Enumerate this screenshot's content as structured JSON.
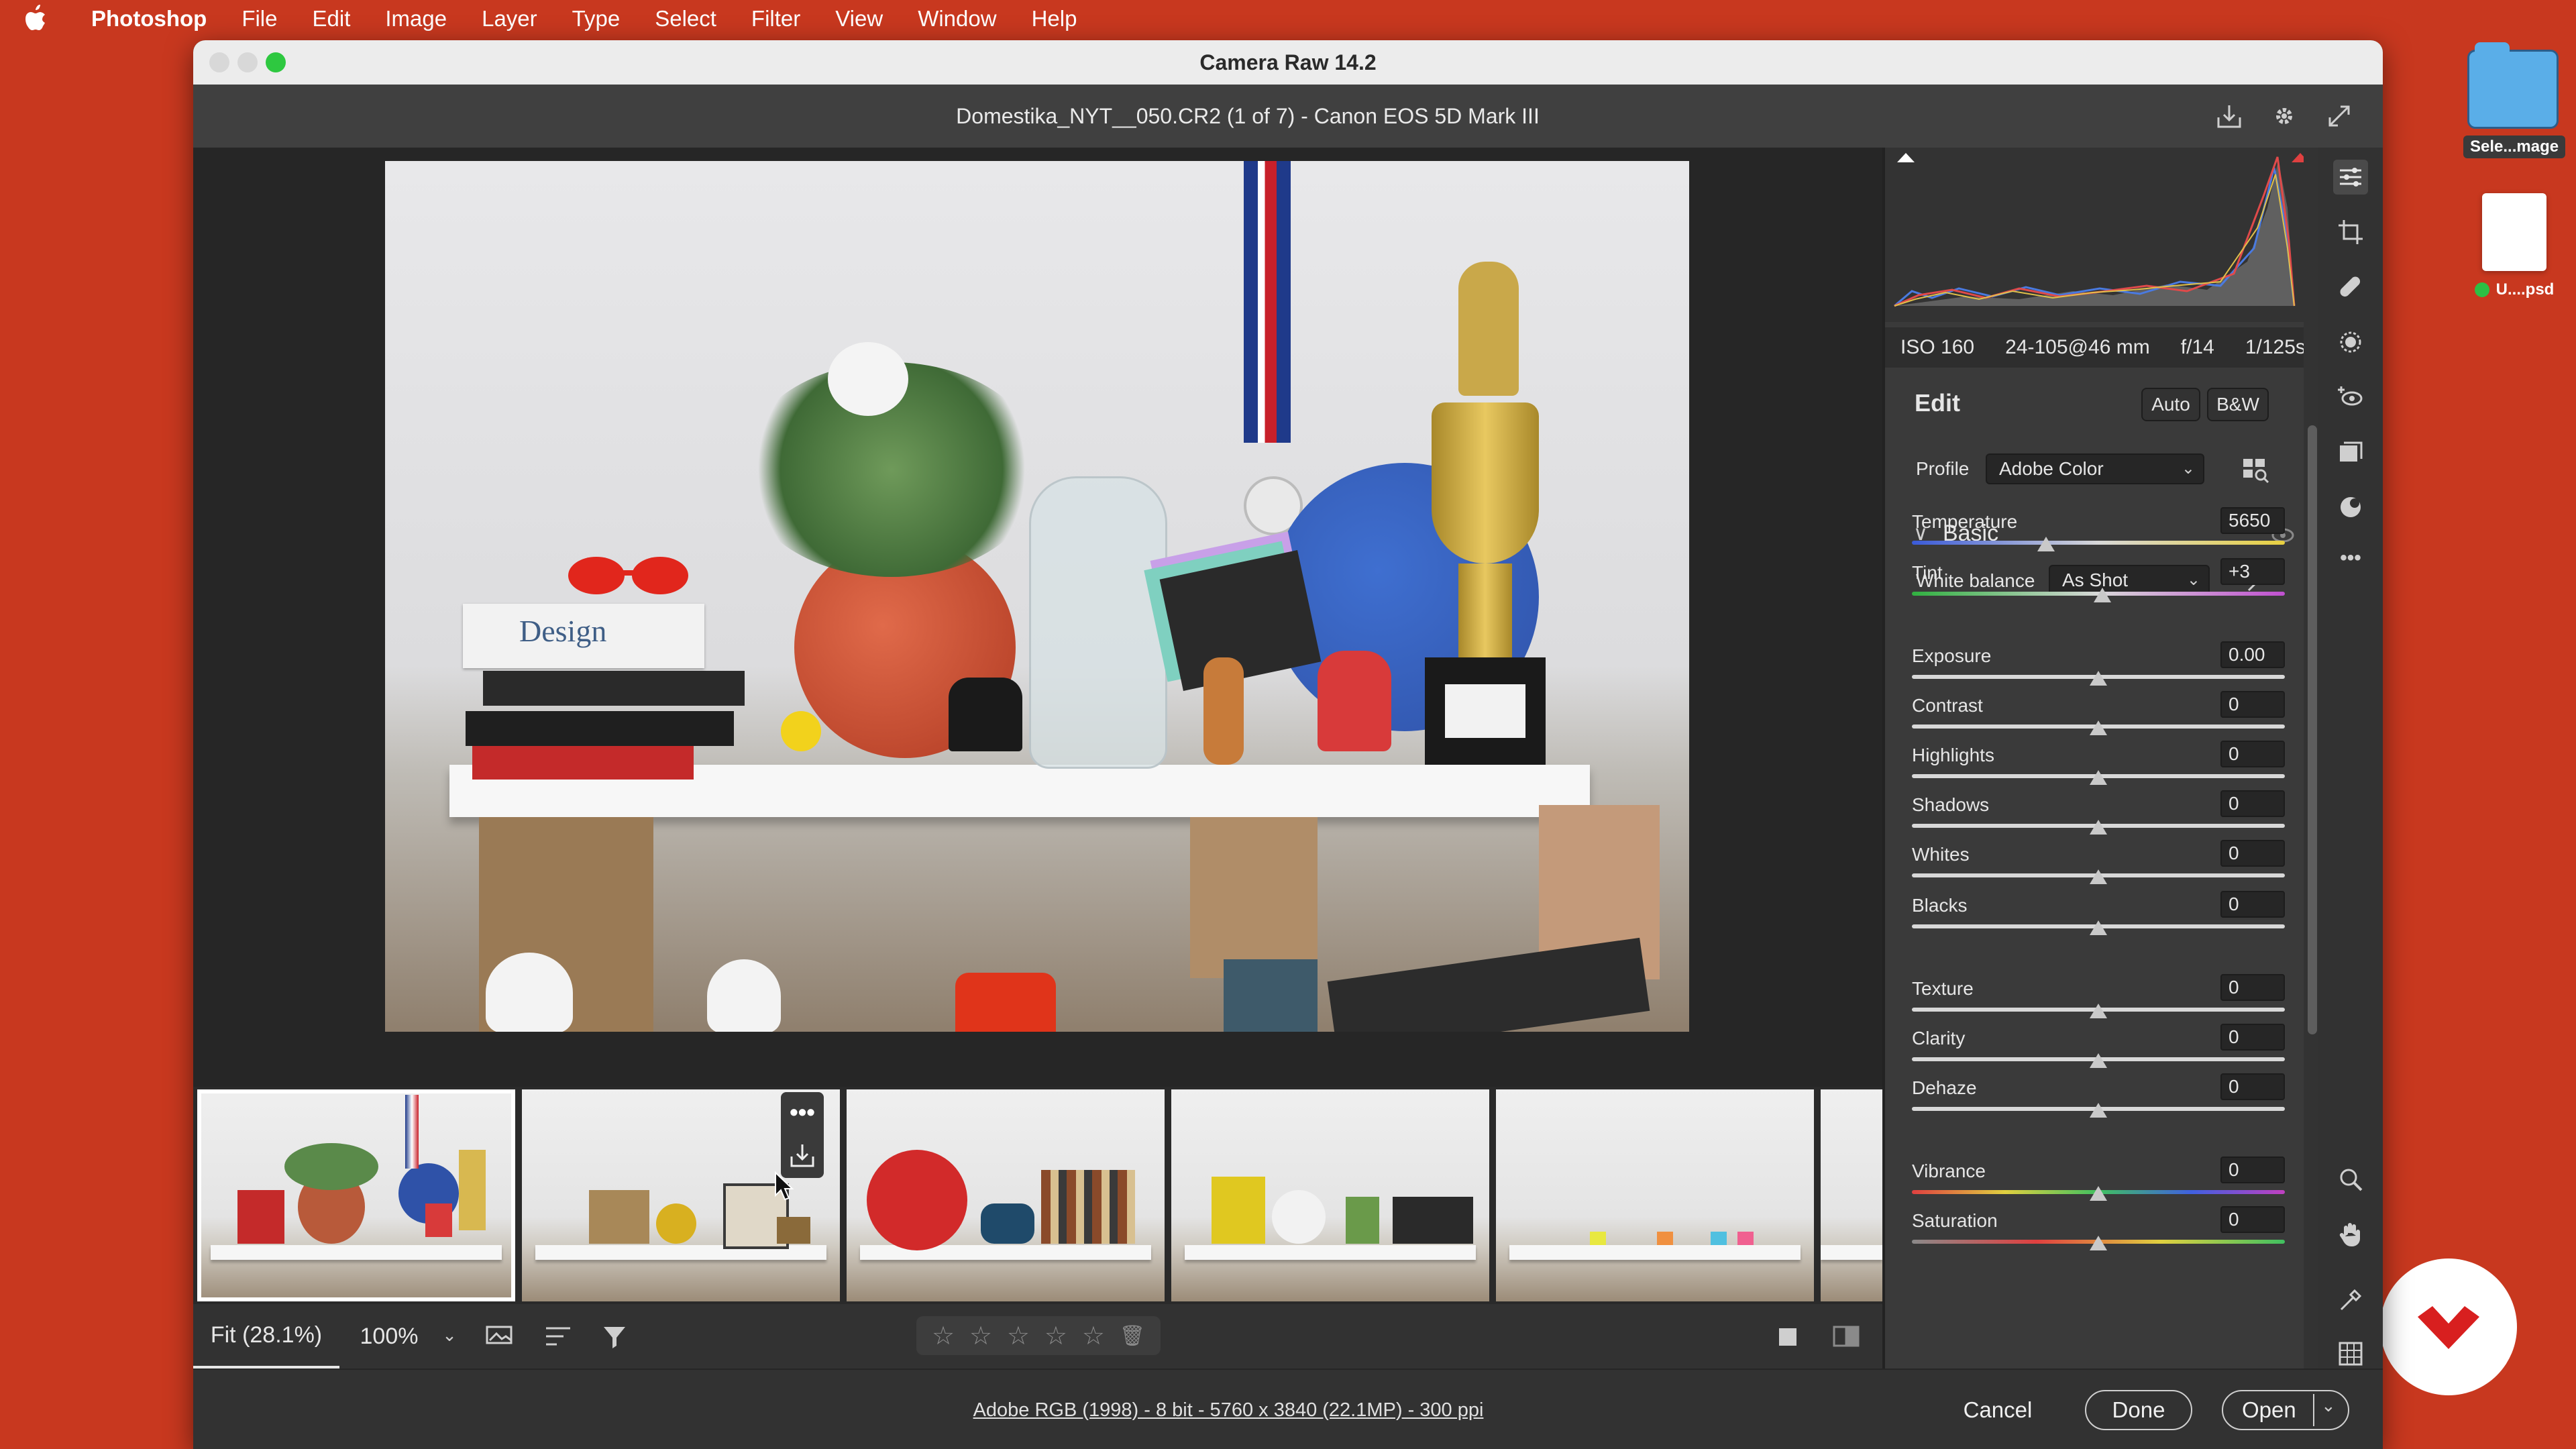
{
  "menubar": {
    "app": "Photoshop",
    "items": [
      "File",
      "Edit",
      "Image",
      "Layer",
      "Type",
      "Select",
      "Filter",
      "View",
      "Window",
      "Help"
    ]
  },
  "desktop": {
    "folder_label": "Sele...mage",
    "psd_label": "U....psd"
  },
  "window": {
    "title": "Camera Raw 14.2",
    "file_header": "Domestika_NYT__050.CR2 (1 of 7)  -  Canon EOS 5D Mark III"
  },
  "preview_toolbar": {
    "fit": "Fit (28.1%)",
    "zoom": "100%"
  },
  "exif": [
    "ISO 160",
    "24-105@46 mm",
    "f/14",
    "1/125s"
  ],
  "edit": {
    "title": "Edit",
    "auto": "Auto",
    "bw": "B&W",
    "profile_label": "Profile",
    "profile_value": "Adobe Color",
    "section": "Basic",
    "wb_label": "White balance",
    "wb_value": "As Shot"
  },
  "sliders": [
    {
      "label": "Temperature",
      "value": "5650",
      "position": 0.36
    },
    {
      "label": "Tint",
      "value": "+3",
      "position": 0.51
    },
    {
      "label": "Exposure",
      "value": "0.00",
      "position": 0.5
    },
    {
      "label": "Contrast",
      "value": "0",
      "position": 0.5
    },
    {
      "label": "Highlights",
      "value": "0",
      "position": 0.5
    },
    {
      "label": "Shadows",
      "value": "0",
      "position": 0.5
    },
    {
      "label": "Whites",
      "value": "0",
      "position": 0.5
    },
    {
      "label": "Blacks",
      "value": "0",
      "position": 0.5
    },
    {
      "label": "Texture",
      "value": "0",
      "position": 0.5
    },
    {
      "label": "Clarity",
      "value": "0",
      "position": 0.5
    },
    {
      "label": "Dehaze",
      "value": "0",
      "position": 0.5
    },
    {
      "label": "Vibrance",
      "value": "0",
      "position": 0.5
    },
    {
      "label": "Saturation",
      "value": "0",
      "position": 0.5
    }
  ],
  "footer": {
    "info": "Adobe RGB (1998) - 8 bit - 5760 x 3840 (22.1MP) - 300 ppi",
    "cancel": "Cancel",
    "done": "Done",
    "open": "Open"
  },
  "colors": {
    "desktop": "#c8381f",
    "panel": "#3a3a3a",
    "accent_green": "#2ec840"
  }
}
